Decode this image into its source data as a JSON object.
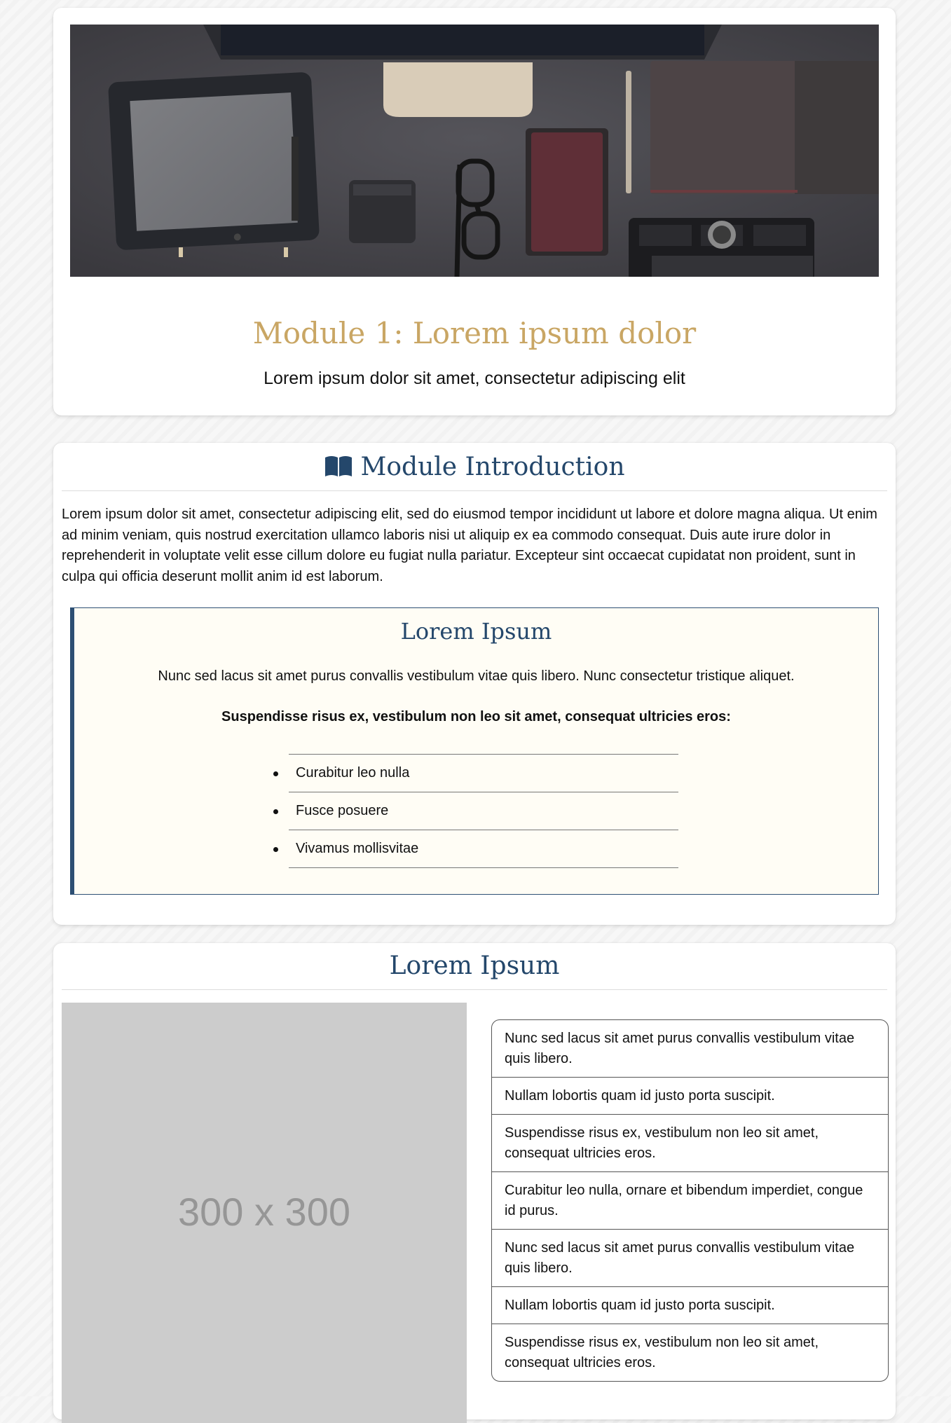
{
  "hero": {
    "image_alt": "Desk flat-lay with tablet, monitor stand, glasses, notebook and pen",
    "title": "Module 1: Lorem ipsum dolor",
    "subtitle": "Lorem ipsum dolor sit amet, consectetur adipiscing elit"
  },
  "intro": {
    "heading": "Module Introduction",
    "heading_icon": "book-open-icon",
    "paragraph": "Lorem ipsum dolor sit amet, consectetur adipiscing elit, sed do eiusmod tempor incididunt ut labore et dolore magna aliqua. Ut enim ad minim veniam, quis nostrud exercitation ullamco laboris nisi ut aliquip ex ea commodo consequat. Duis aute irure dolor in reprehenderit in voluptate velit esse cillum dolore eu fugiat nulla pariatur. Excepteur sint occaecat cupidatat non proident, sunt in culpa qui officia deserunt mollit anim id est laborum.",
    "callout": {
      "title": "Lorem Ipsum",
      "text": "Nunc sed lacus sit amet purus convallis vestibulum vitae quis libero. Nunc consectetur tristique aliquet.",
      "bold_text": "Suspendisse risus ex, vestibulum non leo sit amet, consequat ultricies eros:",
      "items": [
        "Curabitur leo nulla",
        "Fusce posuere",
        "Vivamus mollisvitae"
      ]
    }
  },
  "gallery": {
    "heading": "Lorem Ipsum",
    "placeholder_label": "300 x 300",
    "items": [
      "Nunc sed lacus sit amet purus convallis vestibulum vitae quis libero.",
      "Nullam lobortis quam id justo porta suscipit.",
      "Suspendisse risus ex, vestibulum non leo sit amet, consequat ultricies eros.",
      "Curabitur leo nulla, ornare et bibendum imperdiet, congue id purus.",
      "Nunc sed lacus sit amet purus convallis vestibulum vitae quis libero.",
      "Nullam lobortis quam id justo porta suscipit.",
      "Suspendisse risus ex, vestibulum non leo sit amet, consequat ultricies eros."
    ]
  },
  "colors": {
    "title_gold": "#c9a664",
    "heading_navy": "#24476b",
    "callout_border": "#2d4f73",
    "callout_bg": "#fffdf5",
    "placeholder_bg": "#cccccc"
  }
}
